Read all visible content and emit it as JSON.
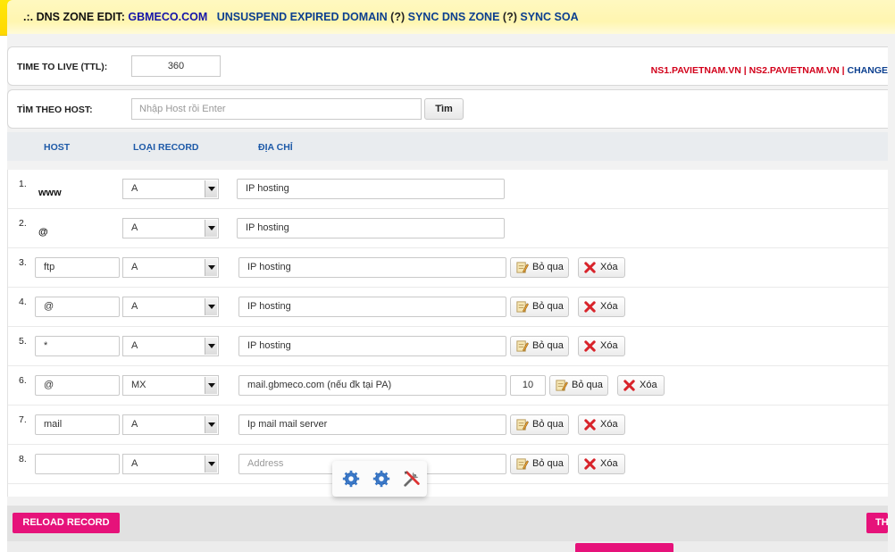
{
  "header": {
    "prefix": ".:. DNS ZONE EDIT: ",
    "domain": "GBMECO.COM",
    "unsuspend": "UNSUSPEND EXPIRED DOMAIN",
    "help1": "(?)",
    "sync_dns": "SYNC DNS ZONE",
    "help2": "(?)",
    "sync_soa": "SYNC SOA"
  },
  "ttl": {
    "label": "TIME TO LIVE (TTL):",
    "value": "360"
  },
  "nameservers": {
    "ns1": "NS1.PAVIETNAM.VN",
    "sep1": " | ",
    "ns2": "NS2.PAVIETNAM.VN",
    "sep2": " | ",
    "change": "CHANGE"
  },
  "search": {
    "label": "TÌM THEO HOST:",
    "placeholder": "Nhập Host rồi Enter",
    "button": "Tìm"
  },
  "columns": {
    "host": "HOST",
    "type": "LOẠI RECORD",
    "address": "ĐỊA CHỈ"
  },
  "records": [
    {
      "num": "1.",
      "host": "www",
      "type": "A",
      "address": "IP hosting"
    },
    {
      "num": "2.",
      "host": "@",
      "type": "A",
      "address": "IP hosting"
    },
    {
      "num": "3.",
      "host": "ftp",
      "type": "A",
      "address": "IP hosting",
      "skip": "Bỏ qua",
      "delete": "Xóa"
    },
    {
      "num": "4.",
      "host": "@",
      "type": "A",
      "address": "IP hosting",
      "skip": "Bỏ qua",
      "delete": "Xóa"
    },
    {
      "num": "5.",
      "host": "*",
      "type": "A",
      "address": "IP hosting",
      "skip": "Bỏ qua",
      "delete": "Xóa"
    },
    {
      "num": "6.",
      "host": "@",
      "type": "MX",
      "address": "mail.gbmeco.com (nếu đk tại PA)",
      "priority": "10",
      "skip": "Bỏ qua",
      "delete": "Xóa"
    },
    {
      "num": "7.",
      "host": "mail",
      "type": "A",
      "address": "Ip mail mail server",
      "skip": "Bỏ qua",
      "delete": "Xóa"
    },
    {
      "num": "8.",
      "host": "",
      "type": "A",
      "address_placeholder": "Address",
      "skip": "Bỏ qua",
      "delete": "Xóa"
    }
  ],
  "footer": {
    "reload": "RELOAD RECORD",
    "right_button": "TH"
  },
  "icons": {
    "skip": "note-pencil-icon",
    "delete": "red-x-icon",
    "tool1": "gear-icon",
    "tool2": "gear-icon",
    "tool3": "tools-icon"
  },
  "colors": {
    "accent": "#e6127a",
    "link": "#1e5aa8",
    "ns": "#d2001a",
    "header_bg": "#ffe70a"
  }
}
